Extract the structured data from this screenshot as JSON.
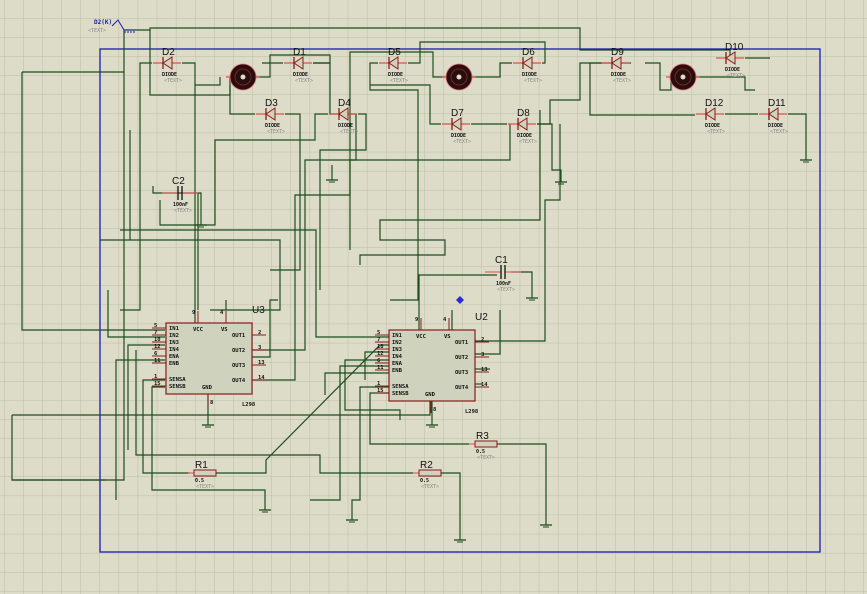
{
  "app": "Proteus ISIS schematic editor",
  "colors": {
    "background": "#dcdcc8",
    "grid": "#bdbda6",
    "wire": "#1e4d1e",
    "border": "#1a1ab4",
    "component_body": "#cfd2bc",
    "component_outline": "#8a1a1a",
    "motor": "#2a0d0d"
  },
  "terminal": {
    "label": "D2(K)",
    "text": "<TEXT>"
  },
  "diodes": [
    {
      "ref": "D2",
      "type": "DIODE",
      "text": "<TEXT>"
    },
    {
      "ref": "D1",
      "type": "DIODE",
      "text": "<TEXT>"
    },
    {
      "ref": "D5",
      "type": "DIODE",
      "text": "<TEXT>"
    },
    {
      "ref": "D6",
      "type": "DIODE",
      "text": "<TEXT>"
    },
    {
      "ref": "D9",
      "type": "DIODE",
      "text": "<TEXT>"
    },
    {
      "ref": "D10",
      "type": "DIODE",
      "text": "<TEXT>"
    },
    {
      "ref": "D3",
      "type": "DIODE",
      "text": "<TEXT>"
    },
    {
      "ref": "D4",
      "type": "DIODE",
      "text": "<TEXT>"
    },
    {
      "ref": "D7",
      "type": "DIODE",
      "text": "<TEXT>"
    },
    {
      "ref": "D8",
      "type": "DIODE",
      "text": "<TEXT>"
    },
    {
      "ref": "D12",
      "type": "DIODE",
      "text": "<TEXT>"
    },
    {
      "ref": "D11",
      "type": "DIODE",
      "text": "<TEXT>"
    }
  ],
  "capacitors": [
    {
      "ref": "C2",
      "value": "100nF",
      "text": "<TEXT>"
    },
    {
      "ref": "C1",
      "value": "100nF",
      "text": "<TEXT>"
    }
  ],
  "resistors": [
    {
      "ref": "R1",
      "value": "0.5",
      "text": "<TEXT>"
    },
    {
      "ref": "R2",
      "value": "0.5",
      "text": "<TEXT>"
    },
    {
      "ref": "R3",
      "value": "0.5",
      "text": "<TEXT>"
    }
  ],
  "ics": [
    {
      "ref": "U3",
      "part": "L298",
      "left_pins": [
        {
          "n": "5",
          "name": "IN1"
        },
        {
          "n": "7",
          "name": "IN2"
        },
        {
          "n": "10",
          "name": "IN3"
        },
        {
          "n": "12",
          "name": "IN4"
        },
        {
          "n": "6",
          "name": "ENA"
        },
        {
          "n": "11",
          "name": "ENB"
        },
        {
          "n": "1",
          "name": "SENSA"
        },
        {
          "n": "15",
          "name": "SENSB"
        }
      ],
      "right_pins": [
        {
          "n": "2",
          "name": "OUT1"
        },
        {
          "n": "3",
          "name": "OUT2"
        },
        {
          "n": "13",
          "name": "OUT3"
        },
        {
          "n": "14",
          "name": "OUT4"
        }
      ],
      "top_pins": [
        {
          "n": "9",
          "name": "VCC"
        },
        {
          "n": "4",
          "name": "VS"
        }
      ],
      "bottom_pins": [
        {
          "n": "8",
          "name": "GND"
        }
      ]
    },
    {
      "ref": "U2",
      "part": "L298",
      "left_pins": [
        {
          "n": "5",
          "name": "IN1"
        },
        {
          "n": "7",
          "name": "IN2"
        },
        {
          "n": "10",
          "name": "IN3"
        },
        {
          "n": "12",
          "name": "IN4"
        },
        {
          "n": "6",
          "name": "ENA"
        },
        {
          "n": "11",
          "name": "ENB"
        },
        {
          "n": "1",
          "name": "SENSA"
        },
        {
          "n": "15",
          "name": "SENSB"
        }
      ],
      "right_pins": [
        {
          "n": "2",
          "name": "OUT1"
        },
        {
          "n": "3",
          "name": "OUT2"
        },
        {
          "n": "13",
          "name": "OUT3"
        },
        {
          "n": "14",
          "name": "OUT4"
        }
      ],
      "top_pins": [
        {
          "n": "9",
          "name": "VCC"
        },
        {
          "n": "4",
          "name": "VS"
        }
      ],
      "bottom_pins": [
        {
          "n": "8",
          "name": "GND"
        }
      ]
    }
  ],
  "motors": [
    {
      "type": "motor"
    },
    {
      "type": "motor"
    },
    {
      "type": "motor"
    }
  ]
}
